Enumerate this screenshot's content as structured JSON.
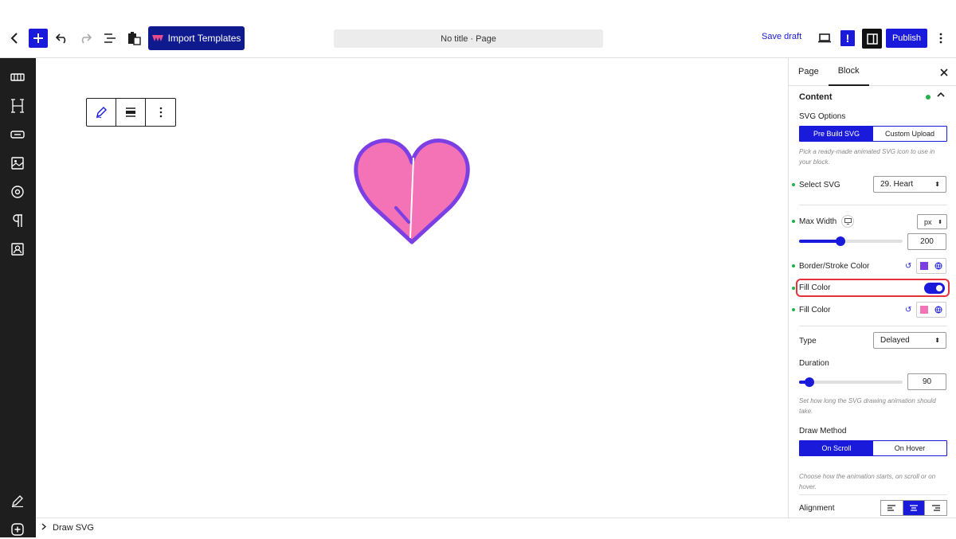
{
  "toolbar": {
    "import_label": "Import Templates",
    "page_title": "No title · Page",
    "save_draft": "Save draft",
    "warn_label": "!",
    "publish": "Publish"
  },
  "panel": {
    "tabs": [
      "Page",
      "Block"
    ],
    "active_tab": "Block",
    "section": "Content",
    "svg_options_label": "SVG Options",
    "svg_source": [
      "Pre Build SVG",
      "Custom Upload"
    ],
    "svg_source_selected": "Pre Build SVG",
    "svg_help": "Pick a ready-made animated SVG icon to use in your block.",
    "select_svg_label": "Select SVG",
    "select_svg_value": "29. Heart",
    "max_width_label": "Max Width",
    "max_width_unit": "px",
    "max_width_value": "200",
    "max_width_fraction": 0.4,
    "border_color_label": "Border/Stroke Color",
    "border_color": "#7b3fe4",
    "fill_toggle_label": "Fill Color",
    "fill_toggle_on": true,
    "fill_color_label": "Fill Color",
    "fill_color": "#f472b6",
    "type_label": "Type",
    "type_value": "Delayed",
    "duration_label": "Duration",
    "duration_value": "90",
    "duration_fraction": 0.1,
    "duration_help": "Set how long the SVG drawing animation should take.",
    "draw_method_label": "Draw Method",
    "draw_methods": [
      "On Scroll",
      "On Hover"
    ],
    "draw_method_selected": "On Scroll",
    "draw_help": "Choose how the animation starts, on scroll or on hover.",
    "alignment_label": "Alignment",
    "alignment_selected": "center"
  },
  "breadcrumb": {
    "item": "Draw SVG"
  },
  "colors": {
    "accent": "#1a1adb",
    "import_bg": "#101a8f",
    "heart_stroke": "#7b3fe4",
    "heart_fill": "#f472b6"
  },
  "icons": {
    "left_sidebar": [
      "slider-icon",
      "heading-icon",
      "button-icon",
      "image-icon",
      "circle-icon",
      "paragraph-icon",
      "profile-icon"
    ],
    "block_toolbar": [
      "pen-icon",
      "align-icon",
      "more-vertical-icon"
    ]
  }
}
